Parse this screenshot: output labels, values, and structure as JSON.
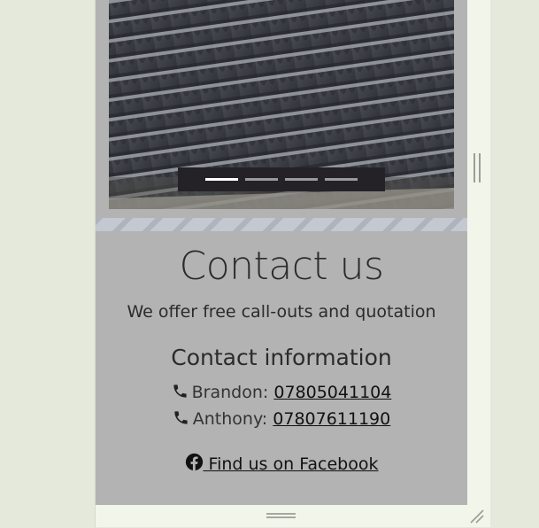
{
  "colors": {
    "page_background": "#e4e9dc",
    "frame_background": "#f2f6ea",
    "content_background": "#b3b3b3",
    "text": "#2b2b2b",
    "slider_nav": "#242226",
    "active_dot": "#ffffff"
  },
  "slider": {
    "image": "roof-tiles-photo",
    "slide_count": 4,
    "active_slide": 1
  },
  "contact": {
    "title": "Contact us",
    "subtitle": "We offer free call-outs and quotation",
    "info_heading": "Contact information",
    "phones": [
      {
        "name_label": "Brandon:",
        "number": "07805041104",
        "icon": "phone-icon"
      },
      {
        "name_label": "Anthony:",
        "number": "07807611190",
        "icon": "phone-icon"
      }
    ],
    "facebook_label": " Find us on Facebook",
    "facebook_icon": "facebook-icon"
  },
  "icons": {
    "scroll_handle": "scroll-handle-icon",
    "bottom_grip": "drag-grip-icon",
    "resize_grip": "resize-grip-icon"
  }
}
